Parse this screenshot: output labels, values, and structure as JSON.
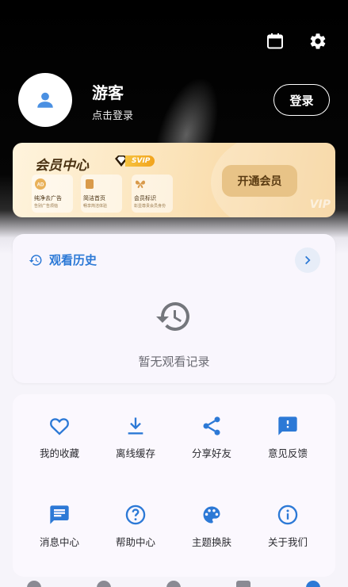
{
  "header": {
    "calendar_icon": "calendar-icon",
    "settings_icon": "gear-icon"
  },
  "profile": {
    "name": "游客",
    "subtitle": "点击登录",
    "login_label": "登录",
    "avatar_icon": "person-icon"
  },
  "vip": {
    "title": "会员中心",
    "badge": "SVIP",
    "perks": [
      {
        "title": "纯净去广告",
        "sub": "告别广告烦恼",
        "icon": "ad-icon"
      },
      {
        "title": "简洁首页",
        "sub": "畅享简洁体验",
        "icon": "home-page-icon"
      },
      {
        "title": "会员标识",
        "sub": "彰显尊贵会员身份",
        "icon": "butterfly-icon"
      }
    ],
    "open_label": "开通会员",
    "watermark": "VIP",
    "accent": "#e8c387"
  },
  "history": {
    "title": "观看历史",
    "empty_text": "暂无观看记录",
    "accent": "#2c79d6"
  },
  "grid": {
    "items": [
      {
        "label": "我的收藏",
        "icon": "heart-icon"
      },
      {
        "label": "离线缓存",
        "icon": "download-icon"
      },
      {
        "label": "分享好友",
        "icon": "share-icon"
      },
      {
        "label": "意见反馈",
        "icon": "feedback-icon"
      },
      {
        "label": "消息中心",
        "icon": "message-icon"
      },
      {
        "label": "帮助中心",
        "icon": "help-icon"
      },
      {
        "label": "主题换肤",
        "icon": "palette-icon"
      },
      {
        "label": "关于我们",
        "icon": "info-icon"
      }
    ],
    "icon_color": "#2c79d6"
  }
}
